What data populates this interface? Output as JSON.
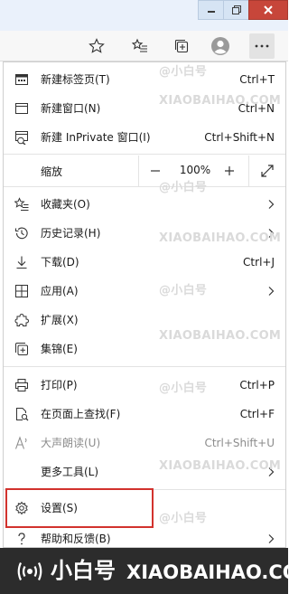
{
  "menu": {
    "items": [
      {
        "label": "新建标签页(T)",
        "shortcut": "Ctrl+T",
        "icon": "new-tab-icon"
      },
      {
        "label": "新建窗口(N)",
        "shortcut": "Ctrl+N",
        "icon": "new-window-icon"
      },
      {
        "label": "新建 InPrivate 窗口(I)",
        "shortcut": "Ctrl+Shift+N",
        "icon": "inprivate-icon"
      },
      {
        "label": "收藏夹(O)",
        "icon": "favorites-icon"
      },
      {
        "label": "历史记录(H)",
        "icon": "history-icon"
      },
      {
        "label": "下载(D)",
        "shortcut": "Ctrl+J",
        "icon": "download-icon"
      },
      {
        "label": "应用(A)",
        "icon": "apps-icon"
      },
      {
        "label": "扩展(X)",
        "icon": "extensions-icon"
      },
      {
        "label": "集锦(E)",
        "icon": "collections-icon"
      },
      {
        "label": "打印(P)",
        "shortcut": "Ctrl+P",
        "icon": "print-icon"
      },
      {
        "label": "在页面上查找(F)",
        "shortcut": "Ctrl+F",
        "icon": "find-icon"
      },
      {
        "label": "大声朗读(U)",
        "shortcut": "Ctrl+Shift+U",
        "icon": "read-aloud-icon"
      },
      {
        "label": "更多工具(L)",
        "icon": "more-tools-icon"
      },
      {
        "label": "设置(S)",
        "icon": "gear-icon"
      },
      {
        "label": "帮助和反馈(B)",
        "icon": "help-icon"
      }
    ],
    "zoom": {
      "label": "缩放",
      "value": "100%",
      "minus": "—",
      "plus": "+"
    }
  },
  "watermark": {
    "cn": "@小白号",
    "en": "XIAOBAIHAO.COM"
  },
  "footer": {
    "cn": "小白号",
    "en": "XIAOBAIHAO.COM"
  },
  "colors": {
    "highlight": "#d2322d",
    "footer_bg": "#2c2c2c",
    "accent": "#2d6fc4"
  }
}
